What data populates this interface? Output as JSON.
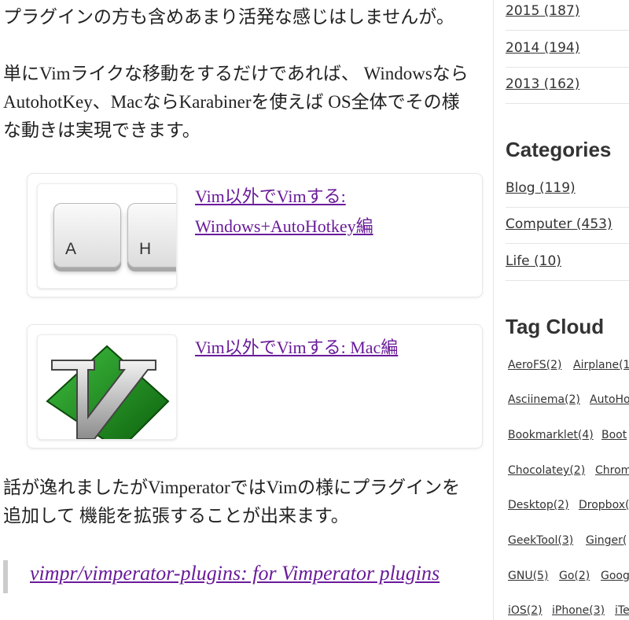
{
  "article": {
    "para1": "プラグインの方も含めあまり活発な感じはしませんが。",
    "para2_line1": "単にVimライクな移動をするだけであれば、 Windowsなら",
    "para2_line2": "AutohotKey、MacならKarabinerを使えば OS全体でその様",
    "para2_line3": "な動きは実現できます。",
    "card1": {
      "title_line1": "Vim以外でVimする:",
      "title_line2": "Windows+AutoHotkey編",
      "key_a": "A",
      "key_h": "H"
    },
    "card2": {
      "title": "Vim以外でVimする: Mac編"
    },
    "para3_line1": "話が逸れましたがVimperatorではVimの様にプラグインを",
    "para3_line2": "追加して 機能を拡張することが出来ます。",
    "quote_link": "vimpr/vimperator-plugins: for Vimperator plugins"
  },
  "sidebar": {
    "archives": [
      "2015 (187)",
      "2014 (194)",
      "2013 (162)"
    ],
    "categories_heading": "Categories",
    "categories": [
      "Blog (119)",
      "Computer (453)",
      "Life (10)"
    ],
    "tagcloud_heading": "Tag Cloud",
    "tags": [
      [
        "AeroFS(2)",
        "Airplane(1"
      ],
      [
        "Asciinema(2)",
        "AutoHo"
      ],
      [
        "Bookmarklet(4)",
        "Boot"
      ],
      [
        "Chocolatey(2)",
        "Chrom"
      ],
      [
        "Desktop(2)",
        "Dropbox("
      ],
      [
        "GeekTool(3)",
        "Ginger("
      ],
      [
        "GNU(5)",
        "Go(2)",
        "Goog"
      ],
      [
        "iOS(2)",
        "iPhone(3)",
        "iTe"
      ]
    ]
  },
  "colors": {
    "link": "#6a1b9a",
    "text": "#222222",
    "vim_green": "#1e8a1e"
  }
}
